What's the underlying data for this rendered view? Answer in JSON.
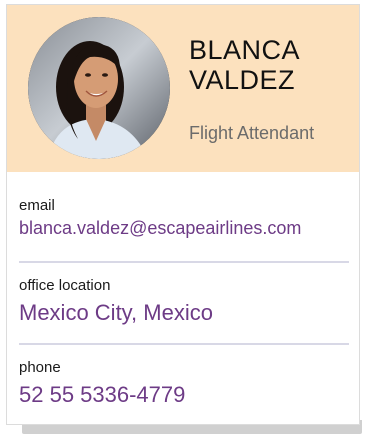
{
  "profile": {
    "first_name": "BLANCA",
    "last_name": "VALDEZ",
    "job_title": "Flight Attendant",
    "avatar_icon": "person-photo"
  },
  "contact": {
    "email_label": "email",
    "email_value": "blanca.valdez@escapeairlines.com",
    "office_label": "office location",
    "office_value": "Mexico City, Mexico",
    "phone_label": "phone",
    "phone_value": "52 55 5336-4779"
  },
  "colors": {
    "header_bg": "#fce1be",
    "value_text": "#6d3b86",
    "divider": "#d8d8e6"
  }
}
